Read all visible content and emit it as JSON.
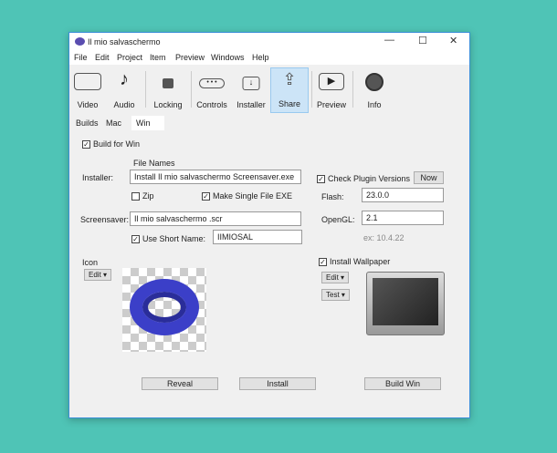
{
  "window": {
    "title": "Il mio salvaschermo"
  },
  "menu": [
    "File",
    "Edit",
    "Project",
    "Item",
    "Preview",
    "Windows",
    "Help"
  ],
  "toolbar": [
    {
      "label": "Video",
      "icon": "video-icon"
    },
    {
      "label": "Audio",
      "icon": "music-note-icon"
    },
    {
      "label": "Locking",
      "icon": "padlock-icon"
    },
    {
      "label": "Controls",
      "icon": "controls-icon"
    },
    {
      "label": "Installer",
      "icon": "installer-icon"
    },
    {
      "label": "Share",
      "icon": "share-icon",
      "active": true
    },
    {
      "label": "Preview",
      "icon": "play-icon"
    },
    {
      "label": "Info",
      "icon": "info-icon"
    }
  ],
  "tabs": [
    "Builds",
    "Mac",
    "Win"
  ],
  "form": {
    "build_for_win": "Build for Win",
    "file_names": "File Names",
    "installer_label": "Installer:",
    "installer_value": "Install Il mio salvaschermo  Screensaver.exe",
    "zip": "Zip",
    "single_exe": "Make Single File EXE",
    "screensaver_label": "Screensaver:",
    "screensaver_value": "Il mio salvaschermo .scr",
    "short_name": "Use Short Name:",
    "short_name_value": "IIMIOSAL",
    "check_plugins": "Check Plugin Versions",
    "now": "Now",
    "flash_label": "Flash:",
    "flash_value": "23.0.0",
    "opengl_label": "OpenGL:",
    "opengl_value": "2.1",
    "example": "ex: 10.4.22",
    "icon_label": "Icon",
    "edit": "Edit ▾",
    "install_wallpaper": "Install Wallpaper",
    "test": "Test ▾"
  },
  "buttons": {
    "reveal": "Reveal",
    "install": "Install",
    "build": "Build Win"
  },
  "colors": {
    "background": "#4fc4b6",
    "active_tool": "#cce4f7"
  }
}
